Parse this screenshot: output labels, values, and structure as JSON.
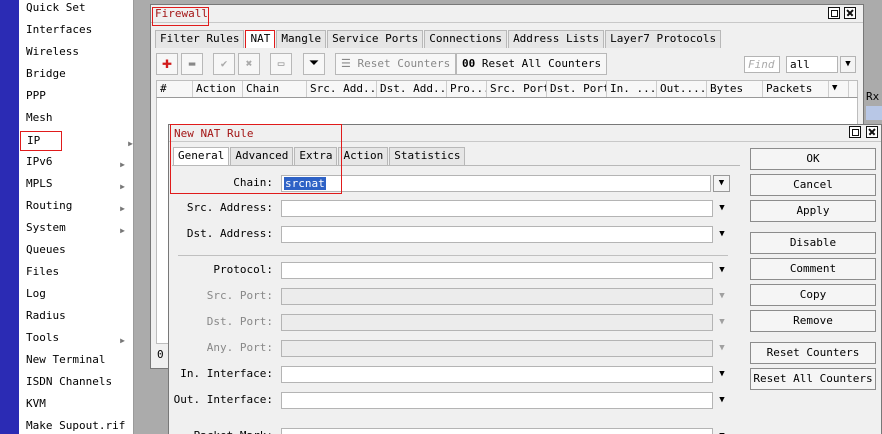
{
  "menu": {
    "items": [
      {
        "label": "Quick Set",
        "submenu": false
      },
      {
        "label": "Interfaces",
        "submenu": false
      },
      {
        "label": "Wireless",
        "submenu": false
      },
      {
        "label": "Bridge",
        "submenu": false
      },
      {
        "label": "PPP",
        "submenu": false
      },
      {
        "label": "Mesh",
        "submenu": false
      },
      {
        "label": "IP",
        "submenu": true
      },
      {
        "label": "IPv6",
        "submenu": true
      },
      {
        "label": "MPLS",
        "submenu": true
      },
      {
        "label": "Routing",
        "submenu": true
      },
      {
        "label": "System",
        "submenu": true
      },
      {
        "label": "Queues",
        "submenu": false
      },
      {
        "label": "Files",
        "submenu": false
      },
      {
        "label": "Log",
        "submenu": false
      },
      {
        "label": "Radius",
        "submenu": false
      },
      {
        "label": "Tools",
        "submenu": true
      },
      {
        "label": "New Terminal",
        "submenu": false
      },
      {
        "label": "ISDN Channels",
        "submenu": false
      },
      {
        "label": "KVM",
        "submenu": false
      },
      {
        "label": "Make Supout.rif",
        "submenu": false
      }
    ]
  },
  "firewall": {
    "title": "Firewall",
    "tabs": [
      "Filter Rules",
      "NAT",
      "Mangle",
      "Service Ports",
      "Connections",
      "Address Lists",
      "Layer7 Protocols"
    ],
    "active_tab": "NAT",
    "toolbar": {
      "reset_counters": "Reset Counters",
      "oo": "00",
      "reset_all": "Reset All Counters",
      "find_placeholder": "Find",
      "filter_value": "all"
    },
    "columns": [
      "#",
      "Action",
      "Chain",
      "Src. Add...",
      "Dst. Add...",
      "Pro...",
      "Src. Port",
      "Dst. Port",
      "In. ...",
      "Out....",
      "Bytes",
      "Packets"
    ],
    "count": "0",
    "side_label": "Rx"
  },
  "dialog": {
    "title": "New NAT Rule",
    "tabs": [
      "General",
      "Advanced",
      "Extra",
      "Action",
      "Statistics"
    ],
    "active_tab": "General",
    "chain_label": "Chain:",
    "chain_value": "srcnat",
    "fields": [
      {
        "label": "Src. Address:",
        "enabled": true
      },
      {
        "label": "Dst. Address:",
        "enabled": true
      },
      {
        "label": "Protocol:",
        "enabled": true
      },
      {
        "label": "Src. Port:",
        "enabled": false
      },
      {
        "label": "Dst. Port:",
        "enabled": false
      },
      {
        "label": "Any. Port:",
        "enabled": false
      },
      {
        "label": "In. Interface:",
        "enabled": true
      },
      {
        "label": "Out. Interface:",
        "enabled": true
      },
      {
        "label": "Packet Mark:",
        "enabled": true
      }
    ],
    "buttons": {
      "ok": "OK",
      "cancel": "Cancel",
      "apply": "Apply",
      "disable": "Disable",
      "comment": "Comment",
      "copy": "Copy",
      "remove": "Remove",
      "reset_counters": "Reset Counters",
      "reset_all_counters": "Reset All Counters"
    }
  }
}
